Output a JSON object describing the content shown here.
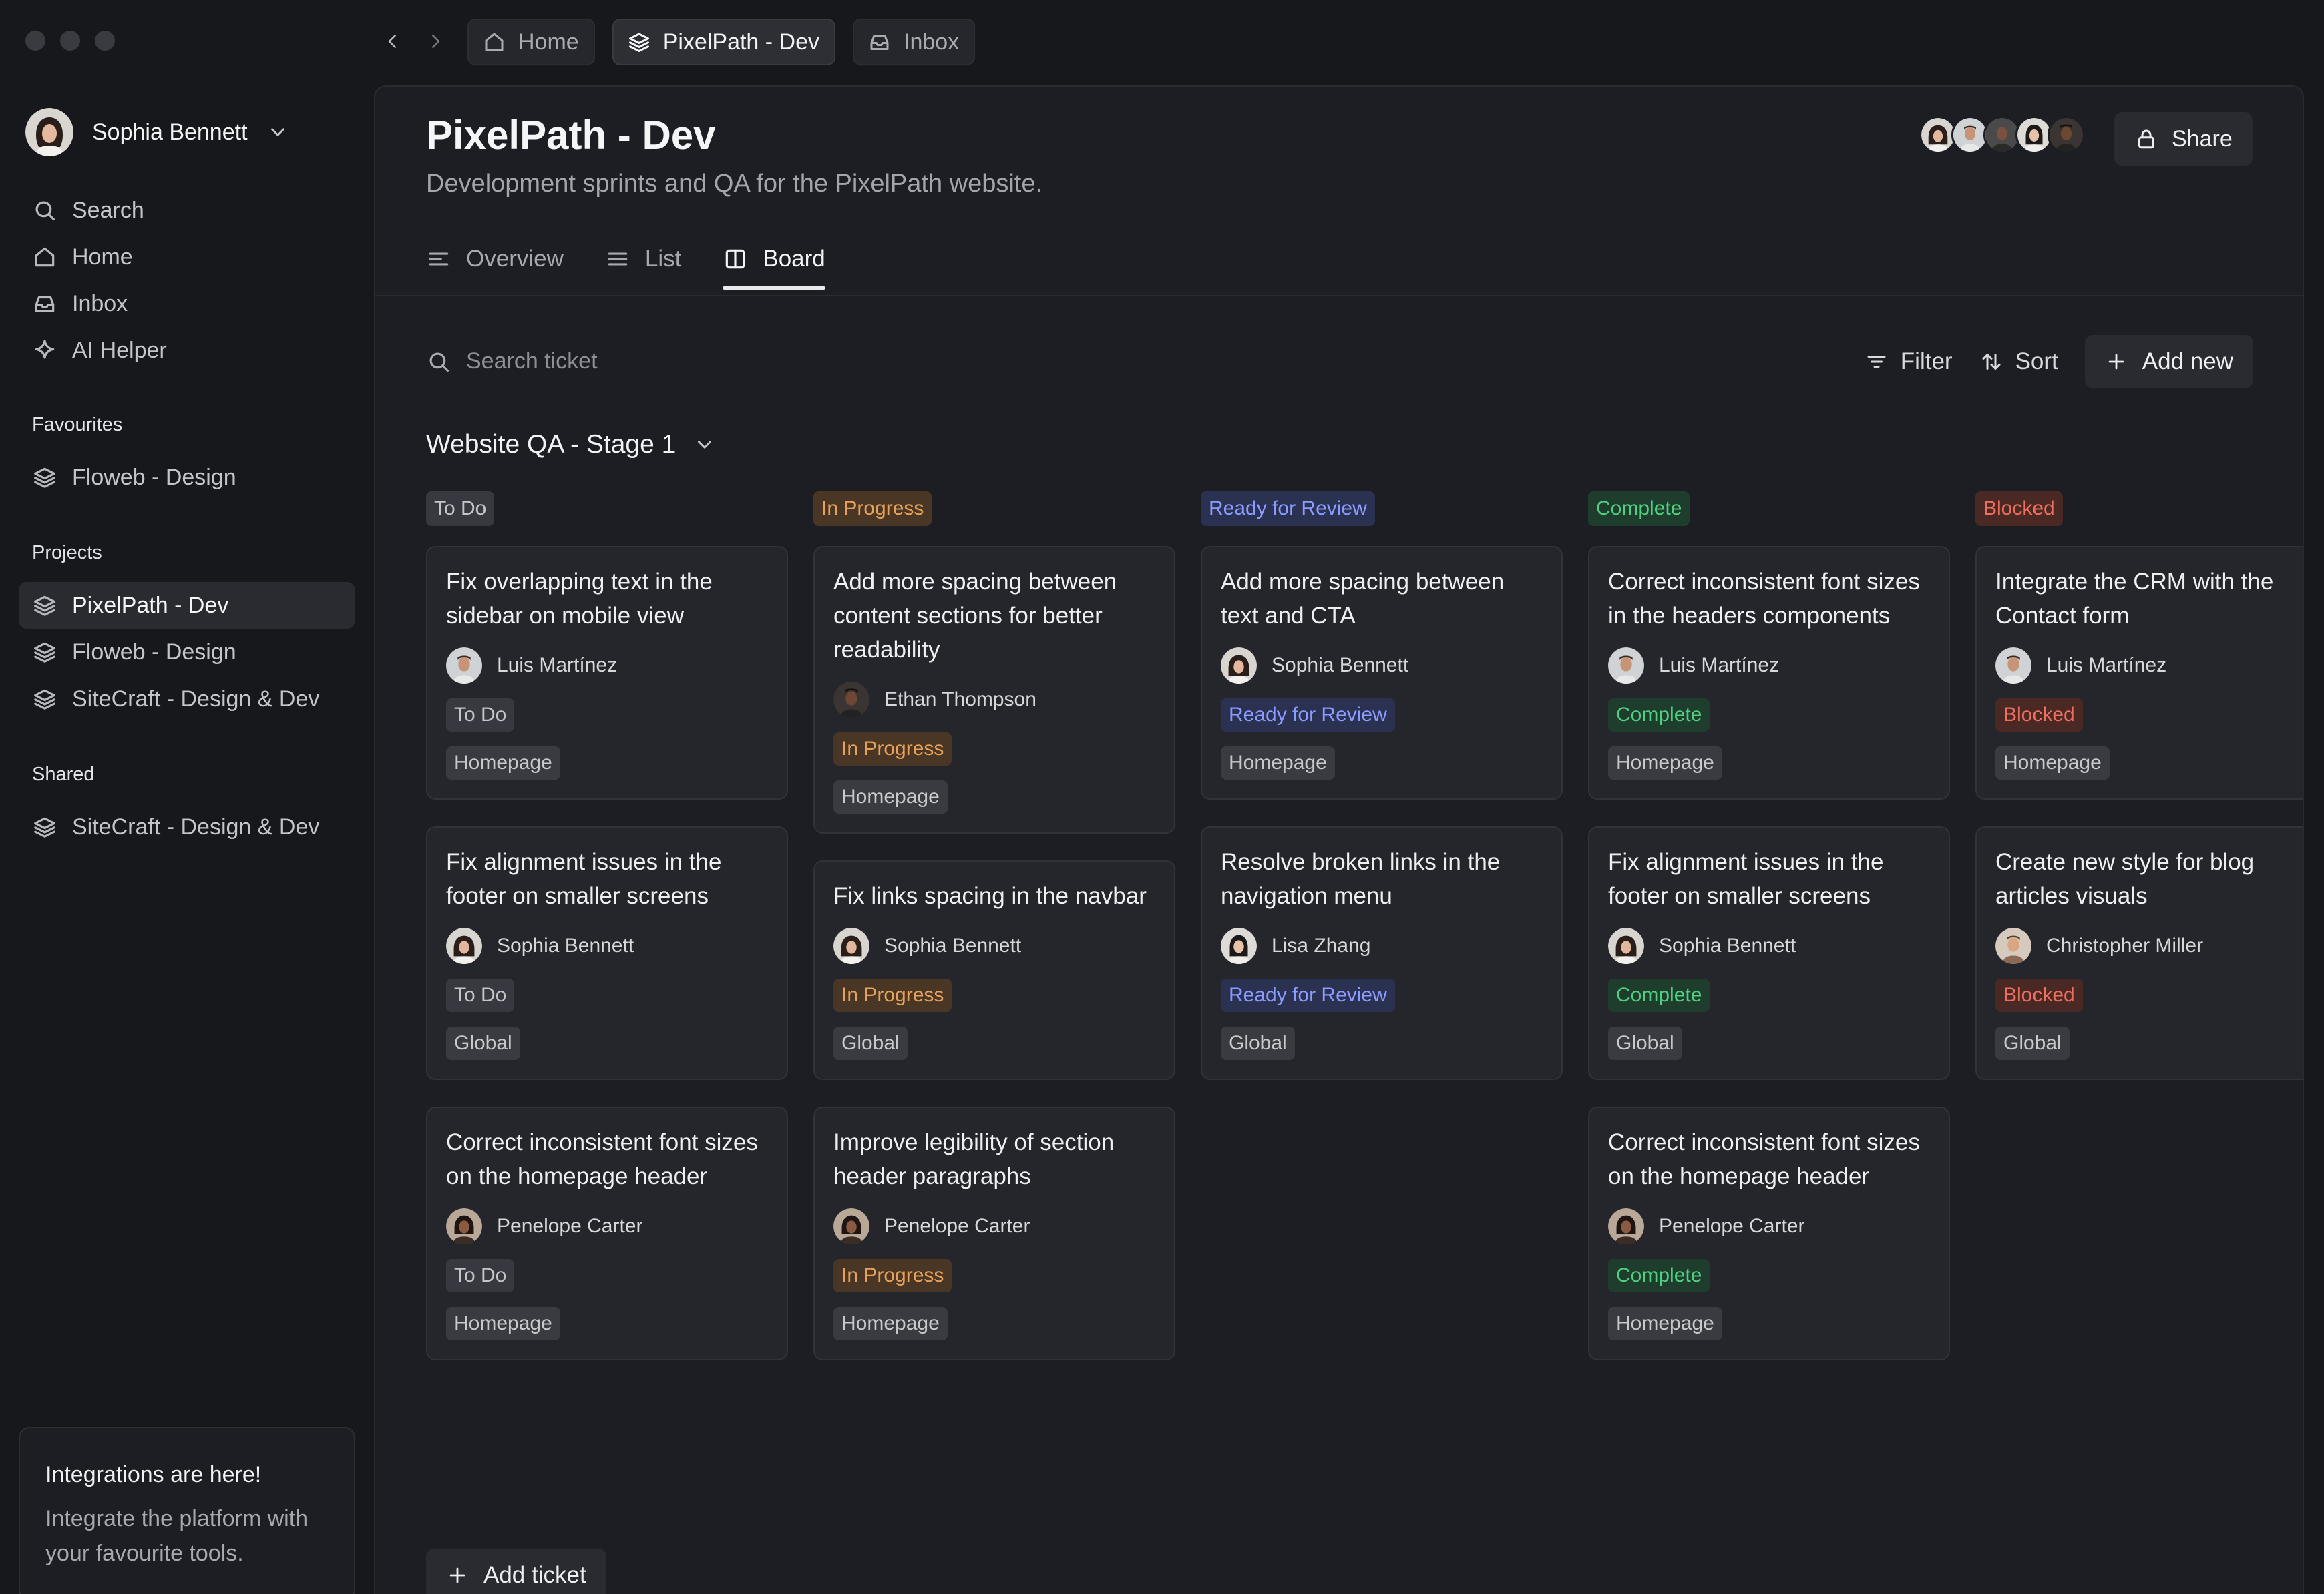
{
  "window": {
    "controls": [
      "close",
      "minimize",
      "maximize"
    ]
  },
  "tabs": [
    {
      "label": "Home",
      "icon": "home-icon",
      "active": false
    },
    {
      "label": "PixelPath - Dev",
      "icon": "layers-icon",
      "active": true
    },
    {
      "label": "Inbox",
      "icon": "inbox-icon",
      "active": false
    }
  ],
  "sidebar": {
    "user": {
      "name": "Sophia Bennett"
    },
    "nav": [
      {
        "label": "Search",
        "icon": "search-icon"
      },
      {
        "label": "Home",
        "icon": "home-icon"
      },
      {
        "label": "Inbox",
        "icon": "inbox-icon"
      },
      {
        "label": "AI Helper",
        "icon": "sparkle-icon"
      }
    ],
    "favourites_heading": "Favourites",
    "favourites": [
      {
        "label": "Floweb - Design",
        "icon": "layers-icon"
      }
    ],
    "projects_heading": "Projects",
    "projects": [
      {
        "label": "PixelPath - Dev",
        "icon": "layers-icon",
        "active": true
      },
      {
        "label": "Floweb - Design",
        "icon": "layers-icon",
        "active": false
      },
      {
        "label": "SiteCraft - Design & Dev",
        "icon": "layers-icon",
        "active": false
      }
    ],
    "shared_heading": "Shared",
    "shared": [
      {
        "label": "SiteCraft - Design & Dev",
        "icon": "layers-icon"
      }
    ],
    "promo": {
      "title": "Integrations are here!",
      "text": "Integrate the platform with your favourite tools."
    }
  },
  "main": {
    "title": "PixelPath - Dev",
    "subtitle": "Development sprints and QA for the PixelPath website.",
    "share_label": "Share",
    "views": [
      {
        "label": "Overview",
        "icon": "overview-icon",
        "active": false
      },
      {
        "label": "List",
        "icon": "list-icon",
        "active": false
      },
      {
        "label": "Board",
        "icon": "board-icon",
        "active": true
      }
    ],
    "search_placeholder": "Search ticket",
    "filter_label": "Filter",
    "sort_label": "Sort",
    "add_new_label": "Add new",
    "group_title": "Website QA - Stage 1",
    "add_ticket_label": "Add ticket"
  },
  "colors": {
    "todo": "#c4c5ca",
    "in_progress": "#e6a15a",
    "ready_for_review": "#8b9bff",
    "complete": "#4fcf81",
    "blocked": "#ee6f5e"
  },
  "board": {
    "columns": [
      {
        "status": "To Do",
        "cls": "st-todo",
        "cards": [
          {
            "title": "Fix overlapping text in the sidebar on mobile view",
            "assignee": "Luis Martínez",
            "status": "To Do",
            "tag": "Homepage"
          },
          {
            "title": "Fix alignment issues in the footer on smaller screens",
            "assignee": "Sophia Bennett",
            "status": "To Do",
            "tag": "Global"
          },
          {
            "title": "Correct inconsistent font sizes on the homepage header",
            "assignee": "Penelope Carter",
            "status": "To Do",
            "tag": "Homepage"
          }
        ]
      },
      {
        "status": "In Progress",
        "cls": "st-prog",
        "cards": [
          {
            "title": "Add more spacing between content sections for better readability",
            "assignee": "Ethan Thompson",
            "status": "In Progress",
            "tag": "Homepage"
          },
          {
            "title": "Fix links spacing in the navbar",
            "assignee": "Sophia Bennett",
            "status": "In Progress",
            "tag": "Global"
          },
          {
            "title": "Improve legibility of section header paragraphs",
            "assignee": "Penelope Carter",
            "status": "In Progress",
            "tag": "Homepage"
          }
        ]
      },
      {
        "status": "Ready for Review",
        "cls": "st-review",
        "cards": [
          {
            "title": "Add more spacing between text and CTA",
            "assignee": "Sophia Bennett",
            "status": "Ready for Review",
            "tag": "Homepage"
          },
          {
            "title": "Resolve broken links in the navigation menu",
            "assignee": "Lisa Zhang",
            "status": "Ready for Review",
            "tag": "Global"
          }
        ]
      },
      {
        "status": "Complete",
        "cls": "st-complete",
        "cards": [
          {
            "title": "Correct inconsistent font sizes in the headers components",
            "assignee": "Luis Martínez",
            "status": "Complete",
            "tag": "Homepage"
          },
          {
            "title": "Fix alignment issues in the footer on smaller screens",
            "assignee": "Sophia Bennett",
            "status": "Complete",
            "tag": "Global"
          },
          {
            "title": "Correct inconsistent font sizes on the homepage header",
            "assignee": "Penelope Carter",
            "status": "Complete",
            "tag": "Homepage"
          }
        ]
      },
      {
        "status": "Blocked",
        "cls": "st-blocked",
        "cards": [
          {
            "title": "Integrate the CRM with the Contact form",
            "assignee": "Luis Martínez",
            "status": "Blocked",
            "tag": "Homepage"
          },
          {
            "title": "Create new style for blog articles visuals",
            "assignee": "Christopher Miller",
            "status": "Blocked",
            "tag": "Global"
          }
        ]
      }
    ]
  }
}
